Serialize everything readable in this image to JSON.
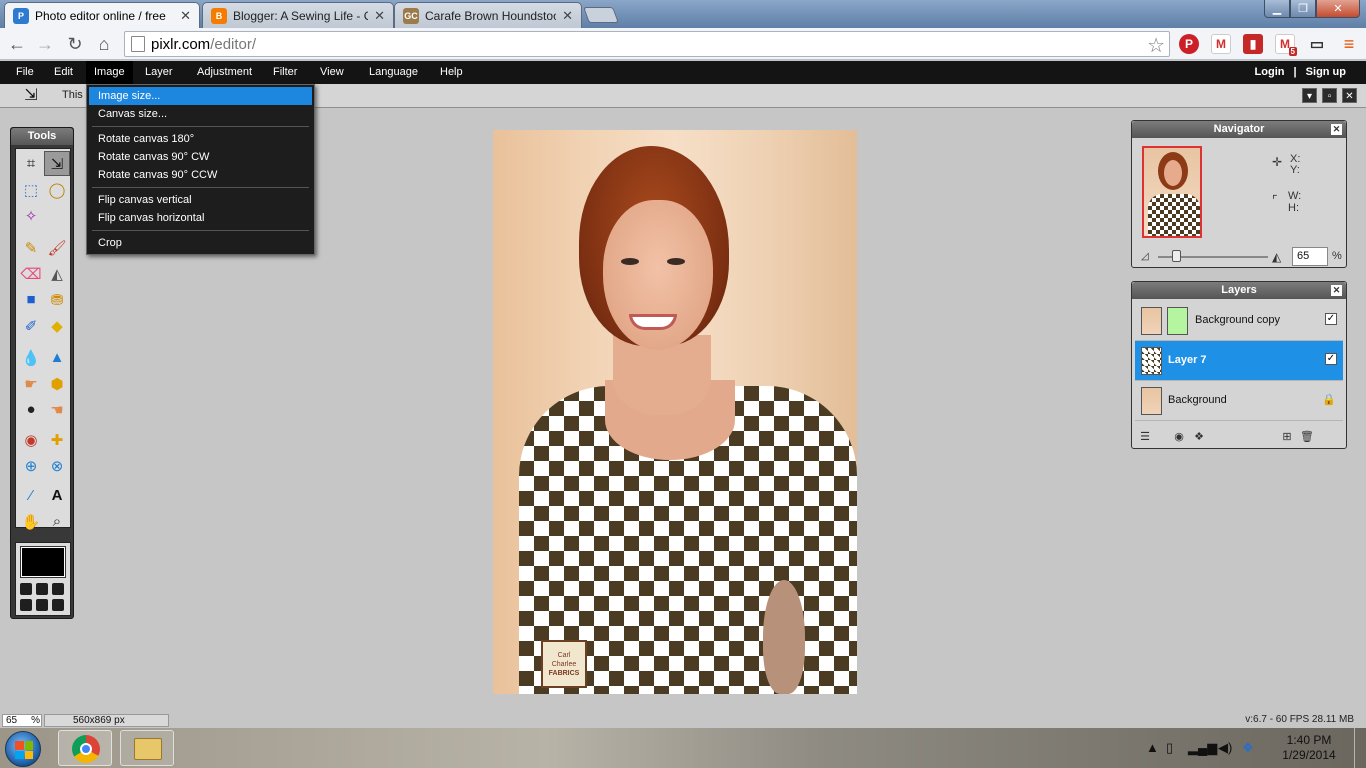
{
  "browser": {
    "tabs": [
      {
        "title": "Photo editor online / free",
        "fav": "P",
        "fav_color": "#2d7bd1",
        "active": true
      },
      {
        "title": "Blogger: A Sewing Life - C",
        "fav": "B",
        "fav_color": "#f57c00",
        "active": false
      },
      {
        "title": "Carafe Brown Houndstoot",
        "fav": "GC",
        "fav_color": "#9b7b4a",
        "active": false
      }
    ],
    "url_domain": "pixlr.com",
    "url_path": "/editor/",
    "icons": [
      "back-icon",
      "forward-icon",
      "reload-icon",
      "home-icon",
      "star-icon",
      "pinterest-icon",
      "gmail-icon",
      "bookmark-icon",
      "gmail-notify-icon",
      "cast-icon",
      "menu-icon"
    ],
    "gmail_badge": "5"
  },
  "menu": {
    "items": [
      "File",
      "Edit",
      "Image",
      "Layer",
      "Adjustment",
      "Filter",
      "View",
      "Language",
      "Help"
    ],
    "login": "Login",
    "separator": "|",
    "signup": "Sign up"
  },
  "options_bar": {
    "text": "This"
  },
  "dropdown": {
    "items": [
      "Image size...",
      "Canvas size...",
      "Rotate canvas 180°",
      "Rotate canvas 90° CW",
      "Rotate canvas 90° CCW",
      "Flip canvas vertical",
      "Flip canvas horizontal",
      "Crop"
    ]
  },
  "tools": {
    "title": "Tools"
  },
  "canvas_image": {
    "logo_line1": "Carl",
    "logo_line2": "Charlee",
    "logo_line3": "FABRICS"
  },
  "navigator": {
    "title": "Navigator",
    "x_label": "X:",
    "y_label": "Y:",
    "w_label": "W:",
    "h_label": "H:",
    "zoom": "65",
    "zoom_unit": "%"
  },
  "layers": {
    "title": "Layers",
    "items": [
      {
        "name": "Background copy",
        "selected": false,
        "visible": true
      },
      {
        "name": "Layer 7",
        "selected": true,
        "visible": true
      },
      {
        "name": "Background",
        "selected": false,
        "locked": true
      }
    ]
  },
  "status": {
    "zoom": "65",
    "zoom_unit": "%",
    "dimensions": "560x869 px",
    "perf": "v:6.7 - 60 FPS 28.11 MB"
  },
  "taskbar": {
    "time": "1:40 PM",
    "date": "1/29/2014"
  }
}
